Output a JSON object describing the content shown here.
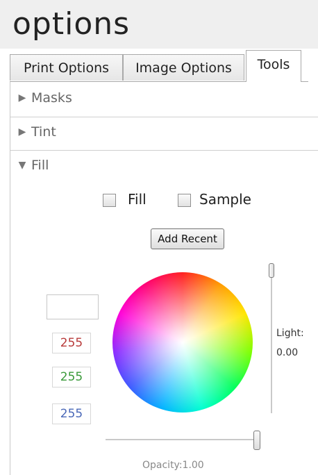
{
  "window": {
    "title": "options"
  },
  "tabs": [
    {
      "label": "Print Options",
      "active": false
    },
    {
      "label": "Image Options",
      "active": false
    },
    {
      "label": "Tools",
      "active": true
    }
  ],
  "sections": [
    {
      "label": "Masks",
      "expanded": false,
      "icon": "triangle-right-icon",
      "glyph": "▶"
    },
    {
      "label": "Tint",
      "expanded": false,
      "icon": "triangle-right-icon",
      "glyph": "▶"
    },
    {
      "label": "Fill",
      "expanded": true,
      "icon": "triangle-down-icon",
      "glyph": "▼"
    }
  ],
  "fill_panel": {
    "fill_checkbox": {
      "label": "Fill",
      "checked": false
    },
    "sample_checkbox": {
      "label": "Sample",
      "checked": false
    },
    "add_recent_label": "Add Recent",
    "swatch_color": "#ffffff",
    "rgb": {
      "r": {
        "value": "255",
        "color": "#b83a3a"
      },
      "g": {
        "value": "255",
        "color": "#3a9a3a"
      },
      "b": {
        "value": "255",
        "color": "#4a68b8"
      }
    },
    "light": {
      "label": "Light:",
      "value": "0.00"
    },
    "opacity": {
      "label": "Opacity:1.00",
      "value": 1.0
    }
  }
}
